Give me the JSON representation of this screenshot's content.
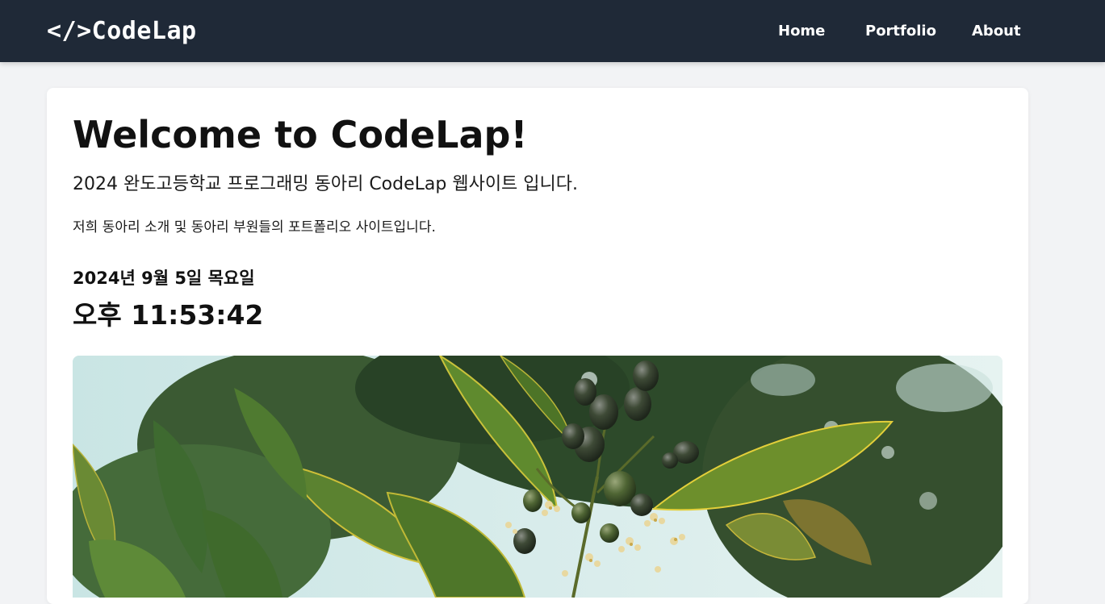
{
  "header": {
    "logo": "</>CodeLap",
    "nav": [
      {
        "label": "Home"
      },
      {
        "label": "Portfolio"
      },
      {
        "label": "About"
      }
    ]
  },
  "main": {
    "title": "Welcome to CodeLap!",
    "subtitle": "2024 완도고등학교 프로그래밍 동아리 CodeLap 웹사이트 입니다.",
    "description": "저희 동아리 소개 및 동아리 부원들의 포트폴리오 사이트입니다.",
    "date": "2024년 9월 5일 목요일",
    "time": "오후 11:53:42"
  },
  "colors": {
    "nav_background": "#1f2937",
    "page_background": "#f2f3f5",
    "card_background": "#ffffff"
  }
}
